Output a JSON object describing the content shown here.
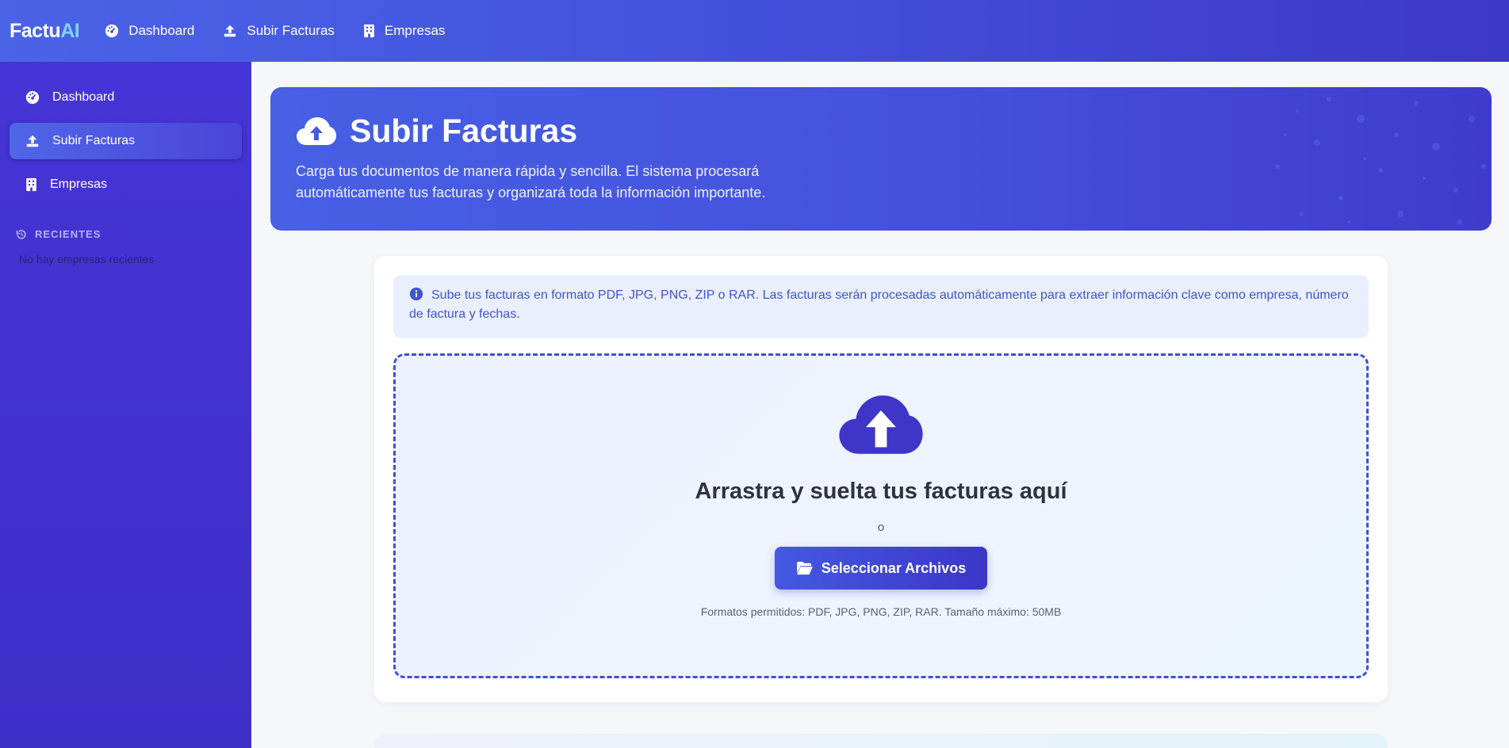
{
  "brand": {
    "name_main": "Factu",
    "name_accent": "AI"
  },
  "topnav": {
    "items": [
      {
        "label": "Dashboard",
        "icon": "gauge-icon"
      },
      {
        "label": "Subir Facturas",
        "icon": "upload-icon"
      },
      {
        "label": "Empresas",
        "icon": "building-icon"
      }
    ]
  },
  "sidebar": {
    "items": [
      {
        "label": "Dashboard",
        "icon": "gauge-icon",
        "active": false
      },
      {
        "label": "Subir Facturas",
        "icon": "upload-icon",
        "active": true
      },
      {
        "label": "Empresas",
        "icon": "building-icon",
        "active": false
      }
    ],
    "recent_heading": "RECIENTES",
    "recent_empty": "No hay empresas recientes"
  },
  "hero": {
    "title": "Subir Facturas",
    "description": "Carga tus documentos de manera rápida y sencilla. El sistema procesará automáticamente tus facturas y organizará toda la información importante."
  },
  "info": {
    "text": "Sube tus facturas en formato PDF, JPG, PNG, ZIP o RAR. Las facturas serán procesadas automáticamente para extraer información clave como empresa, número de factura y fechas."
  },
  "dropzone": {
    "title": "Arrastra y suelta tus facturas aquí",
    "or": "o",
    "button_label": "Seleccionar Archivos",
    "note": "Formatos permitidos: PDF, JPG, PNG, ZIP, RAR. Tamaño máximo: 50MB"
  },
  "colors": {
    "primary": "#4459e0",
    "sidebar": "#4634d6",
    "accent": "#7fd3ff",
    "dropzone_border": "#3f4fd6"
  }
}
